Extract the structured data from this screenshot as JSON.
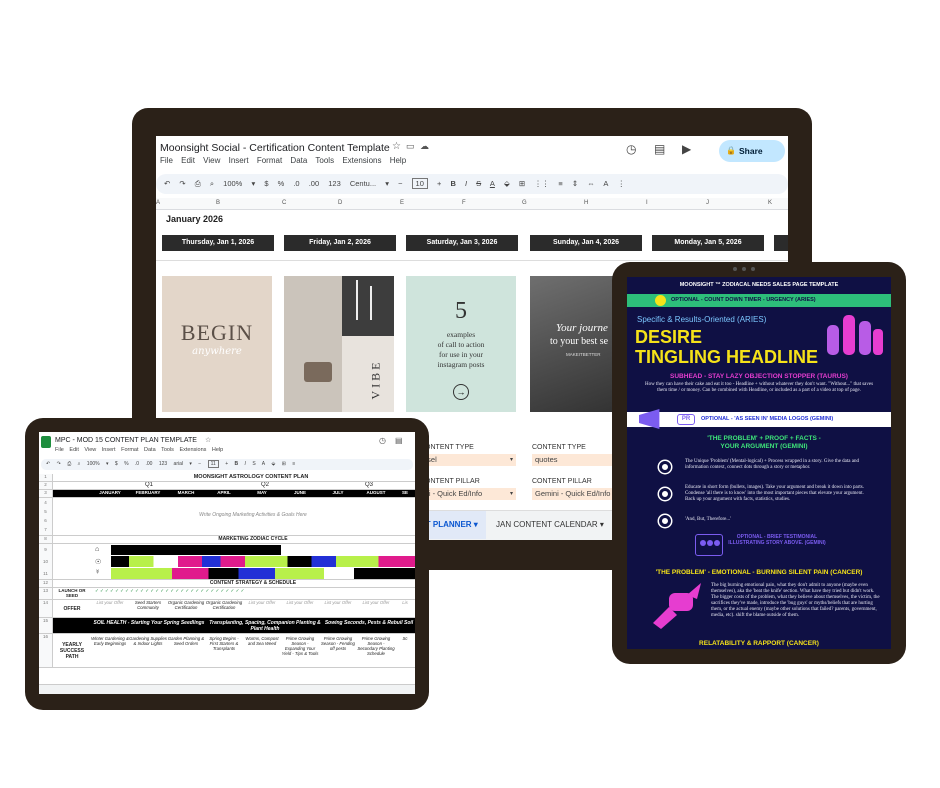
{
  "monitor": {
    "doc_title": "Moonsight Social - Certification Content Template",
    "menu": [
      "File",
      "Edit",
      "View",
      "Insert",
      "Format",
      "Data",
      "Tools",
      "Extensions",
      "Help"
    ],
    "share_label": "Share",
    "toolbar": [
      "↶",
      "↷",
      "⎙",
      "⌕",
      "100%",
      "▾",
      "$",
      "%",
      ".0",
      ".00",
      "123",
      "Centu...",
      "▾",
      "−",
      "10",
      "+",
      "B",
      "I",
      "S",
      "A",
      "⬙",
      "⊞",
      "⋮⋮",
      "≡",
      "⇕",
      "⇔",
      "A",
      "⋮"
    ],
    "columns": [
      "A",
      "B",
      "C",
      "D",
      "E",
      "F",
      "G",
      "H",
      "I",
      "J",
      "K"
    ],
    "month_label": "January 2026",
    "days": [
      "Thursday,  Jan 1, 2026",
      "Friday,  Jan 2, 2026",
      "Saturday,  Jan 3, 2026",
      "Sunday,  Jan 4, 2026",
      "Monday,  Jan 5, 2026"
    ],
    "img1": {
      "big": "BEGIN",
      "script": "anywhere"
    },
    "img2": {
      "vertical": "VIBE"
    },
    "img3": {
      "number": "5",
      "line1": "examples",
      "line2": "of call to action",
      "line3": "for use in your",
      "line4": "instagram posts"
    },
    "img4": {
      "line1": "Your journe",
      "line2": "to your best se",
      "small": "MAKEITBETTER"
    },
    "content_type_label": "CONTENT TYPE",
    "content_type_values": [
      "usel",
      "quotes"
    ],
    "content_pillar_label": "CONTENT PILLAR",
    "content_pillar_values": [
      "ini - Quick Ed/Info",
      "Gemini - Quick Ed/Info"
    ],
    "tabs": [
      "NT PLANNER",
      "JAN CONTENT CALENDAR"
    ]
  },
  "tablet_left": {
    "doc_title": "MPC - MOD 15 CONTENT PLAN TEMPLATE",
    "menu": [
      "File",
      "Edit",
      "View",
      "Insert",
      "Format",
      "Data",
      "Tools",
      "Extensions",
      "Help"
    ],
    "toolbar": [
      "↶",
      "↷",
      "⎙",
      "⌕",
      "100%",
      "▾",
      "$",
      "%",
      ".0",
      ".00",
      "123",
      "arial",
      "▾",
      "−",
      "11",
      "+",
      "B",
      "I",
      "S",
      "A",
      "⬙",
      "⊞",
      "≡"
    ],
    "sheet_title": "MOONSIGHT ASTROLOGY CONTENT PLAN",
    "quarters": [
      "Q1",
      "Q2",
      "Q3"
    ],
    "months": [
      "JANUARY",
      "FEBRUARY",
      "MARCH",
      "APRIL",
      "MAY",
      "JUNE",
      "JULY",
      "AUGUST",
      "SE"
    ],
    "note": "Write Ongoing Marketing Activities & Goals Here",
    "zodiac_cycle": "MARKETING ZODIAC CYCLE",
    "strategy": "CONTENT STRATEGY & SCHEDULE",
    "launch_label": "LAUNCH OR SEED",
    "offer_label": "OFFER",
    "offers": [
      "List your Offer",
      "Seed Starters Community",
      "Organic Gardening Certification",
      "Organic Gardening Certification",
      "List your Offer",
      "List your Offer",
      "List your Offer",
      "List your Offer",
      "Lis"
    ],
    "themes": [
      "SOIL HEALTH - Starting Your Spring Seedlings",
      "Transplanting, Spacing, Companion Planting & Plant Health",
      "Sowing Seconds, Pests & Rebuil Soil"
    ],
    "path_label": "YEARLY SUCCESS PATH",
    "path": [
      "Winter Gardening & Early Beginnings",
      "Gardening Supplies & Indoor Lights",
      "Garden Planning & Seed Orders",
      "Spring Begins - First Starters & Transplants",
      "Worms, Compost and Sea Weed",
      "Prime Growing Season - Expanding Your Yield - Tips & Tools",
      "Prime Growing Season - Fending off pests",
      "Prime Growing Season - Secondary Planting Schedule",
      "Sc"
    ],
    "row_numbers": [
      "1",
      "2",
      "3",
      "4",
      "5",
      "6",
      "7",
      "8",
      "9",
      "10",
      "11",
      "12",
      "13",
      "14",
      "15",
      "16"
    ]
  },
  "tablet_right": {
    "header": "MOONSIGHT ™ ZODIACAL NEEDS SALES PAGE TEMPLATE",
    "timer": "OPTIONAL - COUNT DOWN TIMER - URGENCY (ARIES)",
    "kicker": "Specific & Results-Oriented (ARIES)",
    "headline1": "DESIRE",
    "headline2": "TINGLING HEADLINE",
    "subhead": "SUBHEAD - STAY LAZY OBJECTION STOPPER (TAURUS)",
    "subhead_body": "How they can have their cake and eat it too - Headline + without whatever they don't want. \"Without...\" that saves them time / or money. Can be combined with Headline, or included as a part of a video at top of page.",
    "pr_badge": "PR",
    "logos": "OPTIONAL - 'AS SEEN IN' MEDIA LOGOS (GEMINI)",
    "problem_title": "'THE PROBLEM' + PROOF + FACTS - YOUR ARGUMENT (GEMINI)",
    "bullets": [
      "The Unique 'Problem' (Mental-logical) + Process wrapped in a story. Give the data and information context, connect dots through a story or metaphor.",
      "Educate in short form (bullets, images). Take your argument and break it down into parts. Condense 'all there is to know' into the most important pieces that elevate your argument. Back up your argument with facts, statistics, studies.",
      "'And, But, Therefore...'"
    ],
    "testimonial": "OPTIONAL - BRIEF TESTIMONIAL ILLUSTRATING STORY ABOVE. (GEMINI)",
    "emotional_title": "'THE PROBLEM' - EMOTIONAL - BURNING SILENT PAIN (CANCER)",
    "emotional_body": "The big burning emotional pain, what they don't admit to anyone (maybe even themselves), aka the 'beat the knife' section. What have they tried but didn't work. The bigger costs of the problem, what they believe about themselves, the victim, the sacrifices they've made, introduce the 'bug guys' or myths/beliefs that are hurting them, or the actual enemy (maybe other solutions that failed? parents, government, media, etc). shift the blame outside of them.",
    "relatability": "RELATABILITY & RAPPORT (CANCER)"
  },
  "colors": {
    "frame": "#2b2118",
    "navy": "#0f1044",
    "green_bar": "#2dbe7a",
    "yellow": "#f5e219",
    "magenta": "#e63dd0",
    "purple": "#7b5cf0",
    "share": "#c2e7ff"
  }
}
